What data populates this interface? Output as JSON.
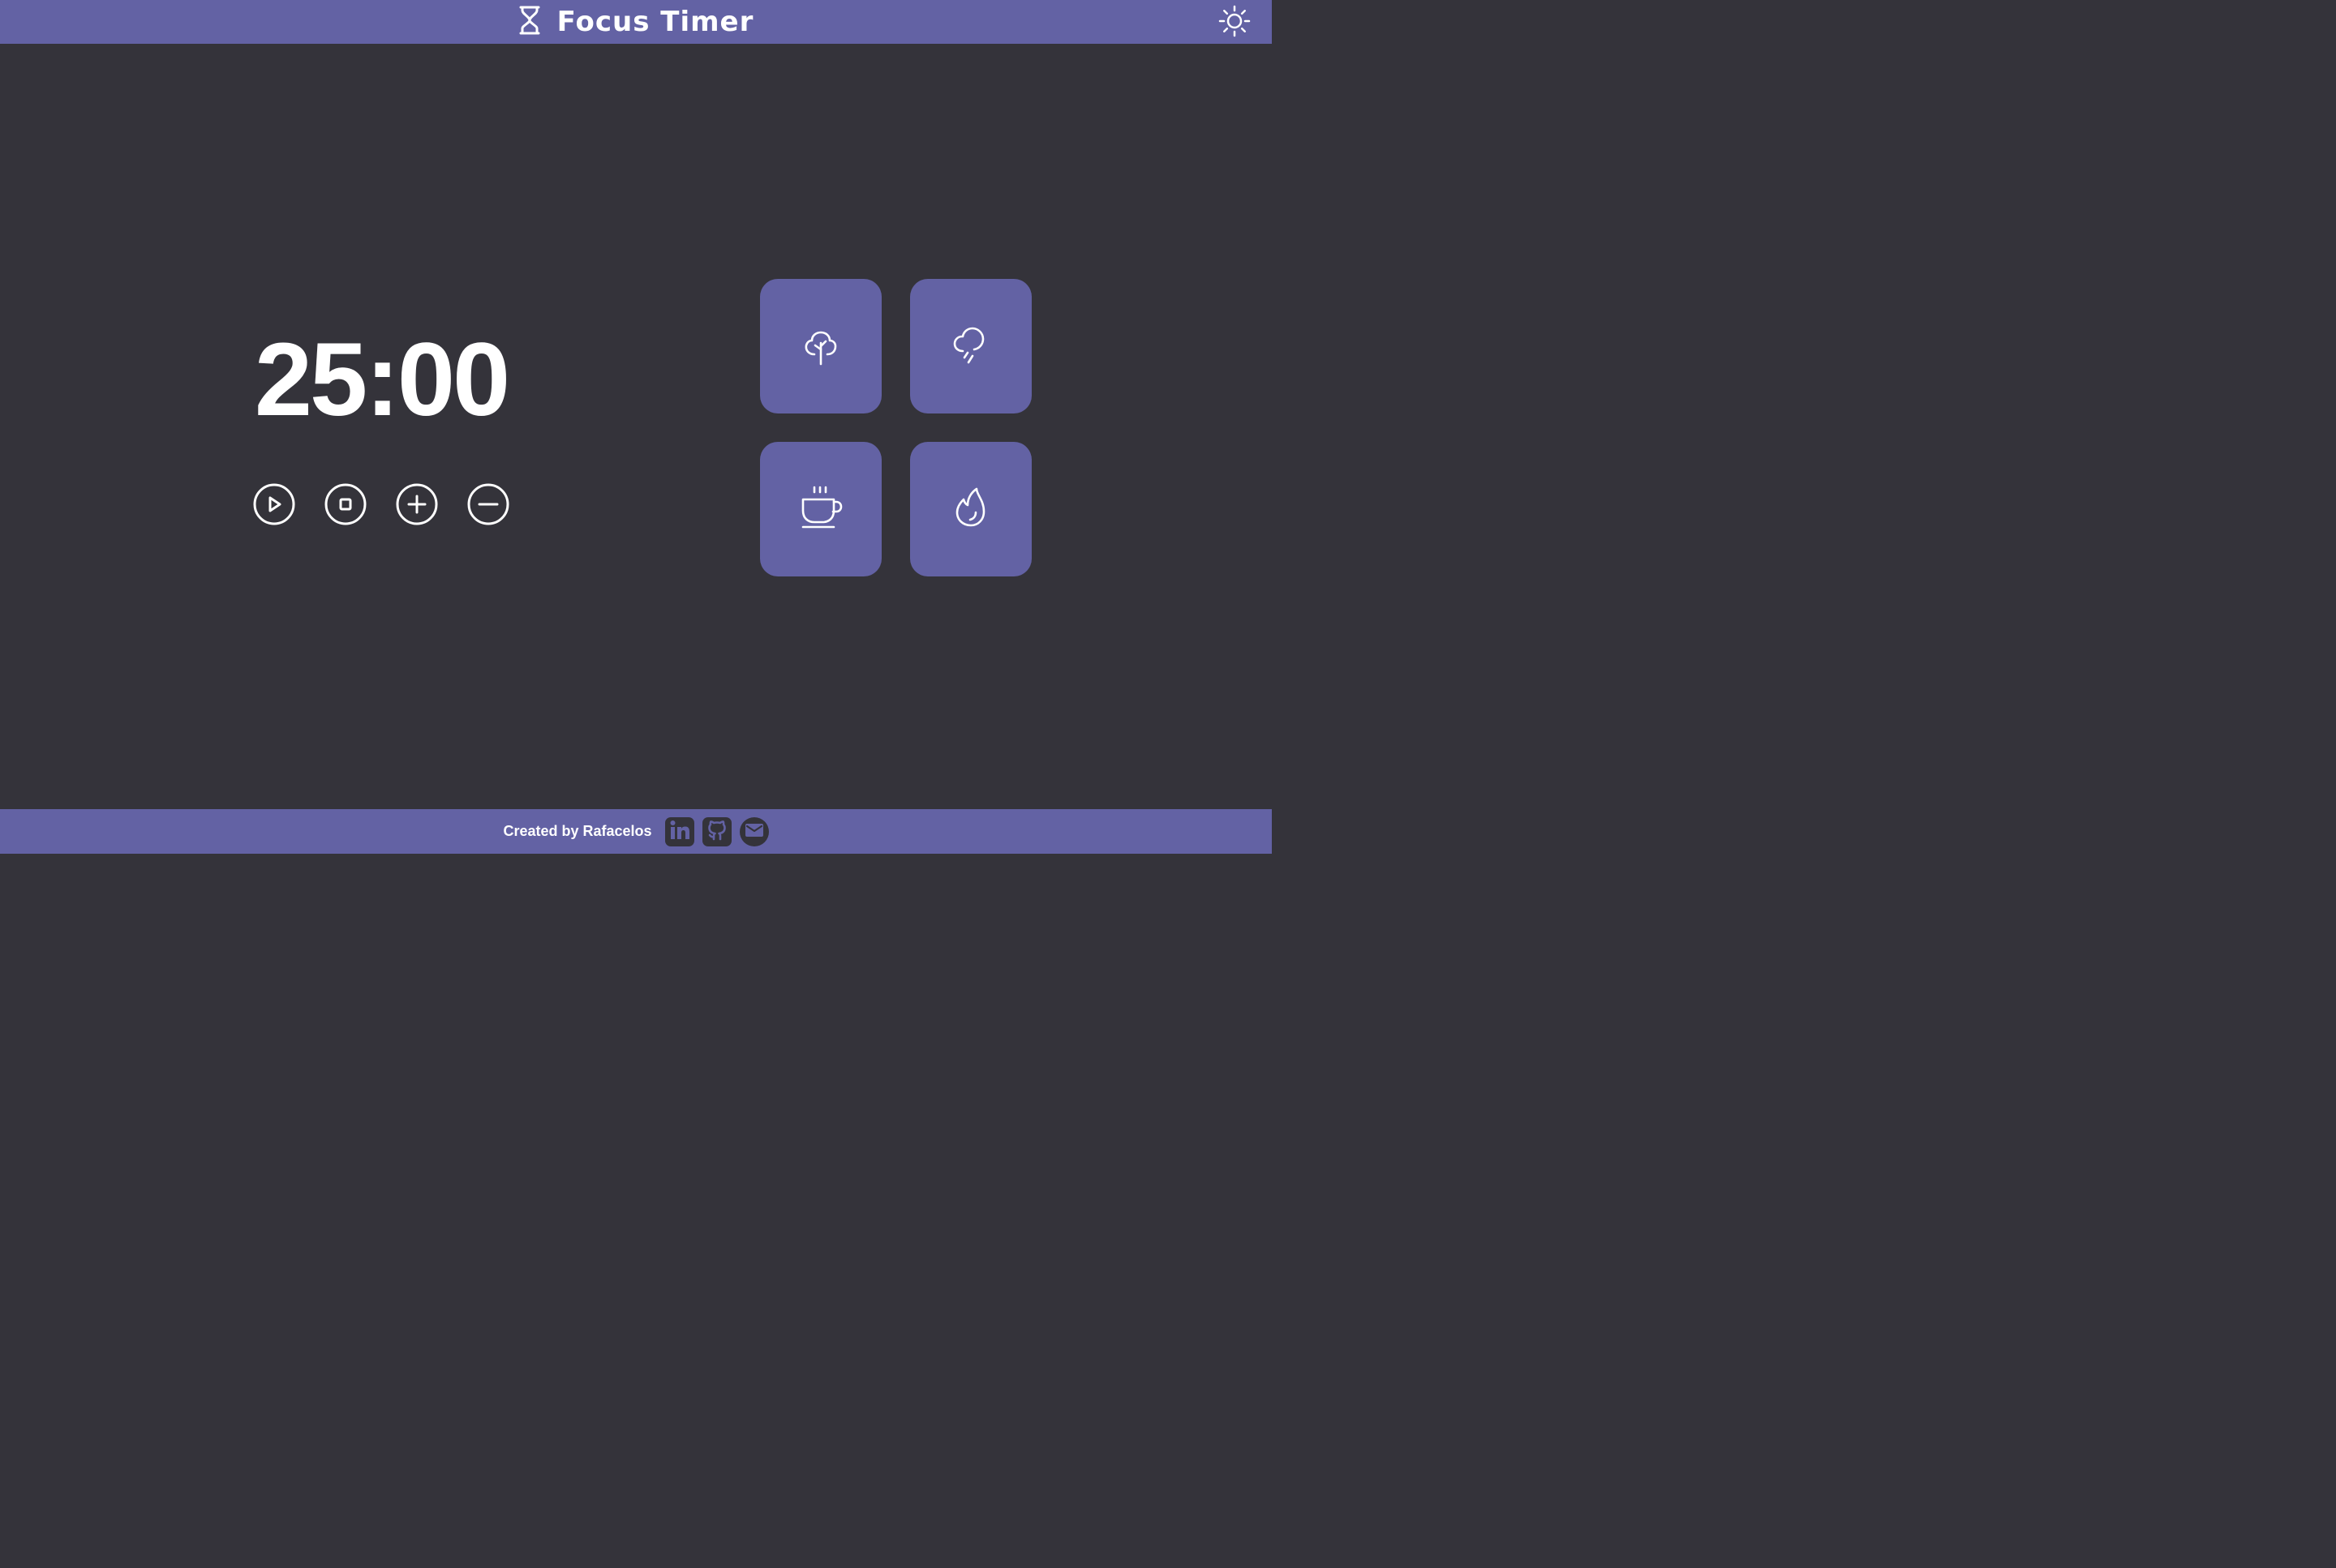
{
  "header": {
    "title": "Focus Timer",
    "logo_icon": "hourglass-icon",
    "theme_toggle_icon": "sun-icon"
  },
  "timer": {
    "display": "25:00"
  },
  "controls": [
    {
      "name": "play-button",
      "icon": "play-icon"
    },
    {
      "name": "stop-button",
      "icon": "stop-icon"
    },
    {
      "name": "increase-button",
      "icon": "plus-icon"
    },
    {
      "name": "decrease-button",
      "icon": "minus-icon"
    }
  ],
  "sounds": [
    {
      "name": "forest-sound-card",
      "icon": "tree-icon"
    },
    {
      "name": "rain-sound-card",
      "icon": "cloud-rain-icon"
    },
    {
      "name": "coffee-shop-sound-card",
      "icon": "coffee-icon"
    },
    {
      "name": "fireplace-sound-card",
      "icon": "flame-icon"
    }
  ],
  "footer": {
    "credit": "Created by Rafacelos",
    "links": [
      {
        "name": "linkedin-link",
        "icon": "linkedin-icon"
      },
      {
        "name": "github-link",
        "icon": "github-icon"
      },
      {
        "name": "email-link",
        "icon": "mail-icon"
      }
    ]
  },
  "colors": {
    "primary": "#6362a4",
    "background": "#34333a",
    "text": "#ffffff"
  }
}
